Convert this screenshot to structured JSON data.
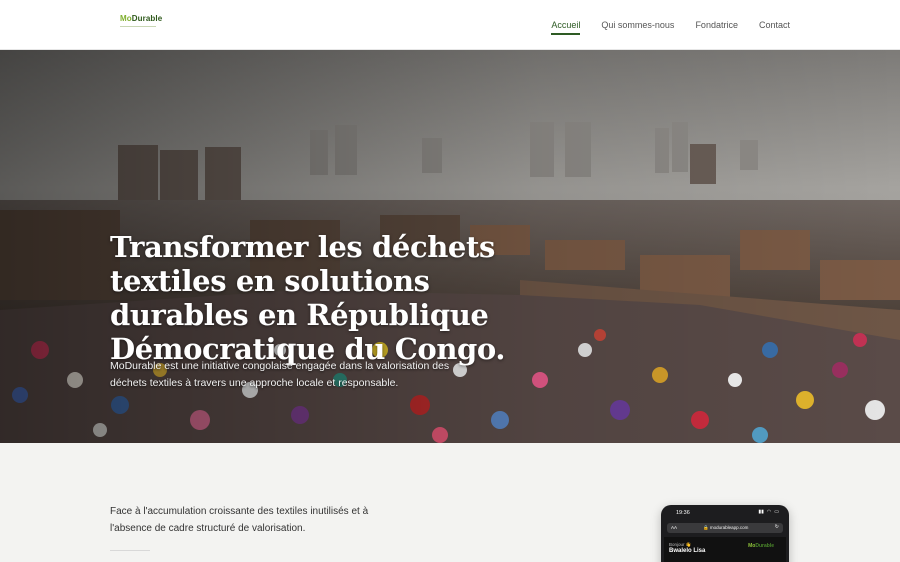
{
  "header": {
    "logo": {
      "mo": "Mo",
      "durable": "Durable"
    },
    "nav": [
      "Accueil",
      "Qui sommes-nous",
      "Fondatrice",
      "Contact"
    ],
    "active_nav": "Accueil"
  },
  "hero": {
    "title": "Transformer les déchets textiles en solutions durables en République Démocratique du Congo.",
    "subtitle": "MoDurable est une initiative congolaise engagée dans la valorisation des déchets textiles à travers une approche locale et responsable."
  },
  "section": {
    "intro": "Face à l'accumulation croissante des textiles inutilisés et à l'absence de cadre structuré de valorisation."
  },
  "phone": {
    "time": "19:36",
    "aa": "AA",
    "url": "🔒 modurableapp.com",
    "reload": "↻",
    "greeting": "Bonjour 👋",
    "name": "Bwalelo Lisa",
    "logo": {
      "mo": "Mo",
      "durable": "Durable"
    }
  },
  "colors": {
    "brand_dark": "#2e5b24",
    "brand_light": "#7fae2d",
    "section_bg": "#f3f3f1"
  }
}
